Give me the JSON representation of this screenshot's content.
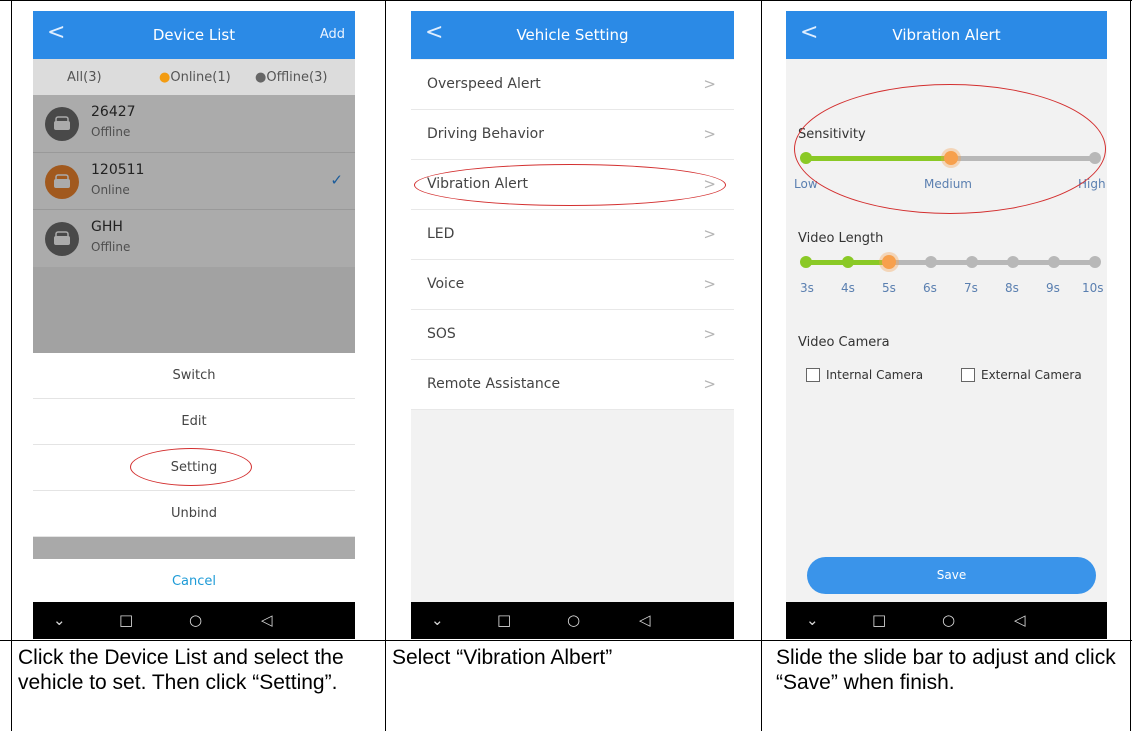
{
  "panel1": {
    "header": {
      "title": "Device List",
      "add": "Add",
      "back": "<"
    },
    "tabs": [
      "All(3)",
      "Online(1)",
      "Offline(3)"
    ],
    "devices": [
      {
        "name": "26427",
        "status": "Offline"
      },
      {
        "name": "120511",
        "status": "Online"
      },
      {
        "name": "GHH",
        "status": "Offline"
      }
    ],
    "sheet": [
      "Switch",
      "Edit",
      "Setting",
      "Unbind"
    ],
    "cancel": "Cancel",
    "caption": "Click the Device List and select the vehicle to set. Then click “Setting”."
  },
  "panel2": {
    "header": {
      "title": "Vehicle Setting",
      "back": "<"
    },
    "items": [
      "Overspeed Alert",
      "Driving Behavior",
      "Vibration Alert",
      "LED",
      "Voice",
      "SOS",
      "Remote Assistance"
    ],
    "caption": "Select “Vibration Albert”"
  },
  "panel3": {
    "header": {
      "title": "Vibration Alert",
      "back": "<"
    },
    "sensitivity": {
      "label": "Sensitivity",
      "ticks": [
        "Low",
        "Medium",
        "High"
      ],
      "selected_index": 1
    },
    "video_length": {
      "label": "Video Length",
      "ticks": [
        "3s",
        "4s",
        "5s",
        "6s",
        "7s",
        "8s",
        "9s",
        "10s"
      ],
      "selected_index": 2
    },
    "video_camera": {
      "label": "Video Camera",
      "options": [
        "Internal Camera",
        "External Camera"
      ]
    },
    "save": "Save",
    "caption": "Slide the slide bar to adjust and click “Save” when finish."
  },
  "navbar_icons": [
    "chevron-down-icon",
    "square-icon",
    "circle-icon",
    "triangle-back-icon"
  ],
  "colors": {
    "accent": "#2b8ae6",
    "green": "#8ac926",
    "orange": "#f7a04d",
    "track": "#b8b8b8",
    "highlight_ring": "#d32f2f"
  }
}
